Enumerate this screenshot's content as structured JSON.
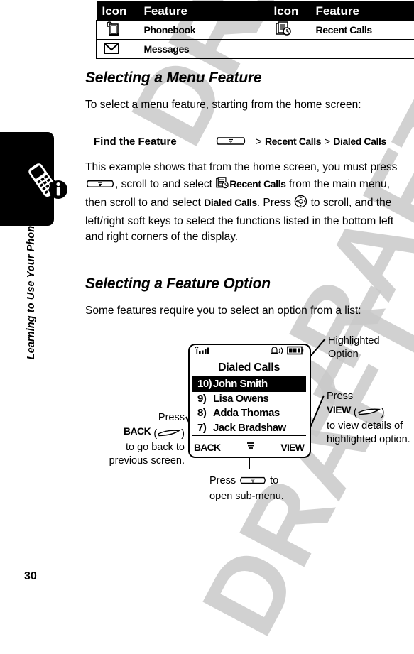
{
  "sidebar": {
    "chapter_label": "Learning to Use Your Phone",
    "page_number": "30",
    "tab_icon": "phone-info-icon"
  },
  "icon_table": {
    "headers": [
      "Icon",
      "Feature",
      "Icon",
      "Feature"
    ],
    "rows": [
      {
        "icon1": "phonebook-icon",
        "feature1": "Phonebook",
        "icon2": "recent-calls-icon",
        "feature2": "Recent Calls"
      },
      {
        "icon1": "messages-envelope-icon",
        "feature1": "Messages",
        "icon2": "",
        "feature2": ""
      }
    ]
  },
  "sections": {
    "menu_feature": {
      "heading": "Selecting a Menu Feature",
      "intro": "To select a menu feature, starting from the home screen:",
      "find_the_feature": {
        "label": "Find the Feature",
        "key_icon": "menu-key-icon",
        "path_prefix": ">",
        "path_1": "Recent Calls",
        "path_sep": ">",
        "path_2": "Dialed Calls"
      },
      "example_p1_a": "This example shows that from the home screen, you must press",
      "example_p1_key": "menu-key-icon",
      "example_p1_b": ", scroll to and select",
      "example_p1_icon": "recent-calls-icon",
      "example_p1_bold1": "Recent Calls",
      "example_p1_c": "from the main menu, then scroll to and select",
      "example_p1_bold2": "Dialed Calls",
      "example_p1_d": ".",
      "example_p2_a": "Press",
      "example_p2_key": "navigation-key-icon",
      "example_p2_b": "to scroll, and the left/right soft keys to select the functions listed in the bottom left and right corners of the display."
    },
    "feature_option": {
      "heading": "Selecting a Feature Option",
      "intro": "Some features require you to select an option from a list:"
    }
  },
  "phone_figure": {
    "status": {
      "signal_icon": "signal-strength-icon",
      "alert_icon": "ringer-alert-icon",
      "battery_icon": "battery-icon"
    },
    "title": "Dialed Calls",
    "list": [
      {
        "num": "10)",
        "name": "John Smith",
        "selected": true
      },
      {
        "num": "9)",
        "name": "Lisa Owens",
        "selected": false
      },
      {
        "num": "8)",
        "name": "Adda Thomas",
        "selected": false
      },
      {
        "num": "7)",
        "name": "Jack Bradshaw",
        "selected": false
      }
    ],
    "softkeys": {
      "left": "BACK",
      "center_icon": "menu-key-icon",
      "right": "VIEW"
    },
    "annotations": {
      "highlighted": "Highlighted Option",
      "view_line1": "Press",
      "view_bold": "VIEW",
      "view_key_icon": "soft-key-icon",
      "view_line2": "to view details of highlighted option.",
      "back_line1": "Press",
      "back_bold": "BACK",
      "back_key_icon": "soft-key-icon",
      "back_line2": "to go back to previous screen.",
      "submenu_line1": "Press",
      "submenu_key_icon": "menu-key-icon",
      "submenu_line2": "to",
      "submenu_line3": "open sub-menu."
    }
  },
  "watermark": {
    "text": "DRAFT",
    "color": "#c9c9c9"
  }
}
